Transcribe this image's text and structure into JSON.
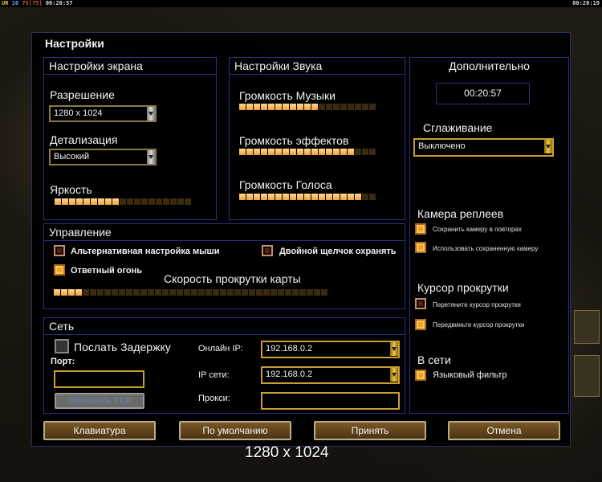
{
  "topbar": {
    "ur": "UR",
    "n1": "10",
    "n2": "75",
    "n3": "[75]",
    "time_left": "00:20:57",
    "time_right": "00:20:19"
  },
  "dialog": {
    "title": "Настройки"
  },
  "screen": {
    "header": "Настройки экрана",
    "resolution_label": "Разрешение",
    "resolution_value": "1280 x 1024",
    "detail_label": "Детализация",
    "detail_value": "Высокий",
    "brightness_label": "Яркость",
    "brightness_level": 9,
    "brightness_max": 19
  },
  "sound": {
    "header": "Настройки Звука",
    "music_label": "Громкость Музыки",
    "music_level": 11,
    "effects_label": "Громкость эффектов",
    "effects_level": 16,
    "voice_label": "Громкость Голоса",
    "voice_level": 17,
    "max": 19
  },
  "extra": {
    "header": "Дополнительно",
    "clock": "00:20:57",
    "aa_label": "Сглаживание",
    "aa_value": "Выключено",
    "replay_camera_label": "Камера реплеев",
    "replay_save": "Сохранить камеру в повторах",
    "replay_use": "Использовать сохраненную камеру",
    "cursor_label": "Курсор прокрутки",
    "cursor_drag": "Перетяните курсор прокрутки",
    "cursor_move": "Передвиньте курсор прокрутки",
    "online_label": "В сети",
    "lang_filter": "Языковый фильтр"
  },
  "control": {
    "header": "Управление",
    "alt_mouse": "Альтернативная настройка мыши",
    "double_click": "Двойной щелчок охранять",
    "return_fire": "Ответный огонь",
    "scroll_label": "Скорость прокрутки карты",
    "scroll_level": 4,
    "max": 38
  },
  "network": {
    "header": "Сеть",
    "send_delay": "Послать Задержку",
    "port_label": "Порт:",
    "refresh_btn": "Обновить TCP",
    "online_ip_label": "Онлайн IP:",
    "online_ip_value": "192.168.0.2",
    "lan_ip_label": "IP сети:",
    "lan_ip_value": "192.168.0.2",
    "proxy_label": "Прокси:"
  },
  "buttons": {
    "keyboard": "Клавиатура",
    "defaults": "По умолчанию",
    "accept": "Принять",
    "cancel": "Отмена"
  },
  "footer": {
    "resolution_caption": "1280 x 1024"
  }
}
